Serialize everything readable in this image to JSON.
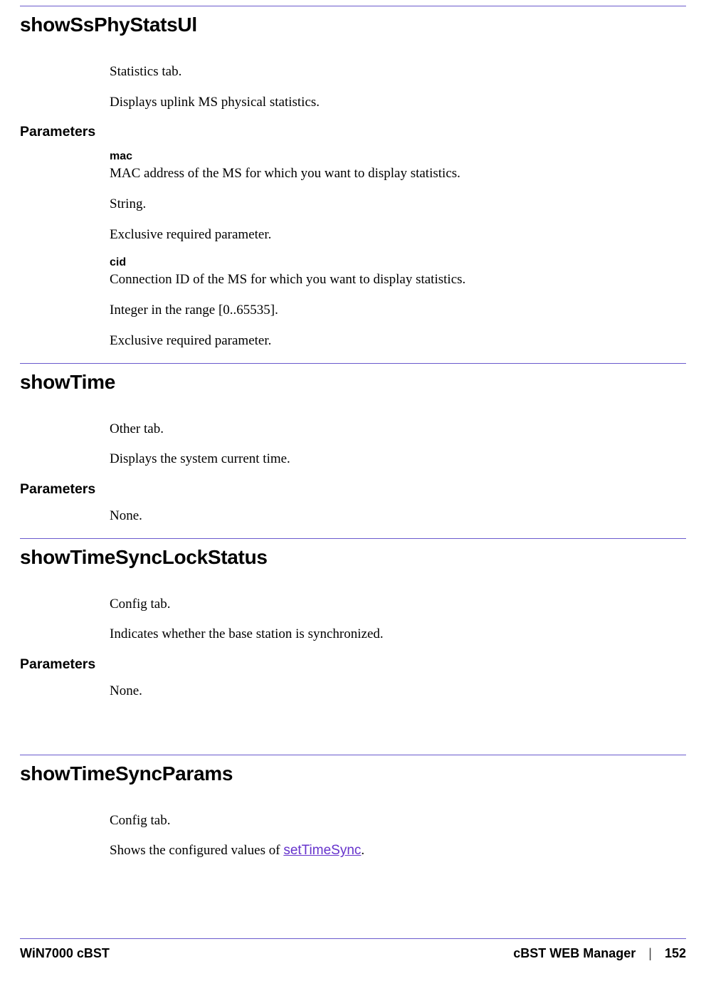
{
  "sections": [
    {
      "title": "showSsPhyStatsUl",
      "desc1": "Statistics tab.",
      "desc2": "Displays uplink MS physical statistics.",
      "paramsHeading": "Parameters",
      "params": [
        {
          "name": "mac",
          "line1": "MAC address of the MS for which you want to display statistics.",
          "line2": "String.",
          "line3": "Exclusive required parameter."
        },
        {
          "name": "cid",
          "line1": "Connection ID of the MS for which you want to display statistics.",
          "line2": "Integer in the range [0..65535].",
          "line3": "Exclusive required parameter."
        }
      ]
    },
    {
      "title": "showTime",
      "desc1": "Other tab.",
      "desc2": "Displays the system current time.",
      "paramsHeading": "Parameters",
      "paramsNone": "None."
    },
    {
      "title": "showTimeSyncLockStatus",
      "desc1": "Config tab.",
      "desc2": "Indicates whether the base station is synchronized.",
      "paramsHeading": "Parameters",
      "paramsNone": "None."
    },
    {
      "title": "showTimeSyncParams",
      "desc1": "Config tab.",
      "desc2_prefix": "Shows the configured values of ",
      "desc2_link": "setTimeSync",
      "desc2_suffix": "."
    }
  ],
  "footer": {
    "left": "WiN7000 cBST",
    "center": "cBST WEB Manager",
    "sep": "|",
    "page": "152"
  }
}
